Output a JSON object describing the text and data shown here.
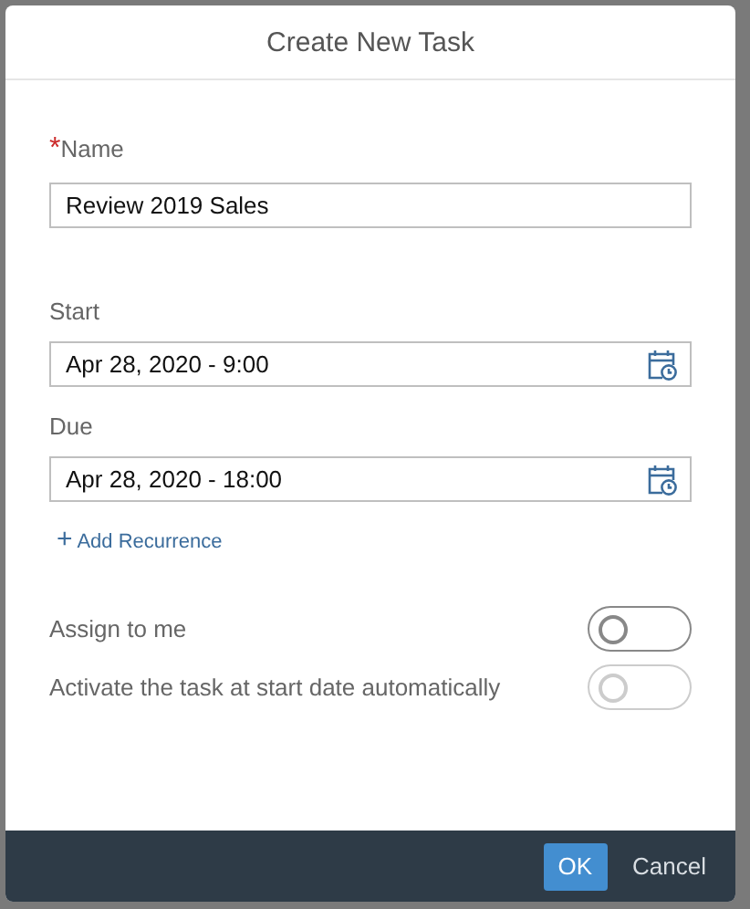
{
  "dialog": {
    "title": "Create New Task"
  },
  "name_field": {
    "label": "Name",
    "required_mark": "*",
    "value": "Review 2019 Sales"
  },
  "date_fields": [
    {
      "label": "Start",
      "value": "Apr 28, 2020 - 9:00"
    },
    {
      "label": "Due",
      "value": "Apr 28, 2020 - 18:00"
    }
  ],
  "add_link": {
    "icon": "+",
    "label": "Add Recurrence"
  },
  "switches": [
    {
      "label": "Assign to me",
      "on": false,
      "disabled": false
    },
    {
      "label": "Activate the task at start date automatically",
      "on": false,
      "disabled": true
    }
  ],
  "buttons": [
    {
      "label": "OK",
      "kind": "primary"
    },
    {
      "label": "Cancel",
      "kind": "plain"
    }
  ]
}
